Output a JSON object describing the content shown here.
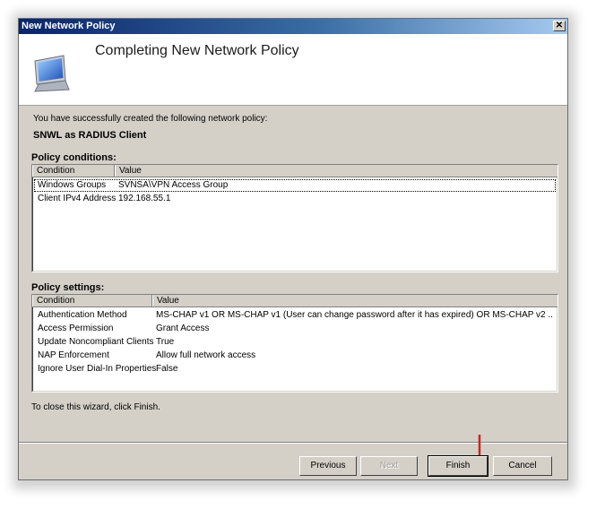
{
  "window": {
    "title": "New Network Policy",
    "close_glyph": "✕"
  },
  "header": {
    "heading": "Completing New Network Policy",
    "icon": "wizard-monitor-icon"
  },
  "intro_text": "You have successfully created the following network policy:",
  "policy_name": "SNWL as RADIUS Client",
  "conditions": {
    "section_label": "Policy conditions:",
    "columns": [
      "Condition",
      "Value"
    ],
    "rows": [
      {
        "condition": "Windows Groups",
        "value": "SVNSA\\VPN Access Group"
      },
      {
        "condition": "Client IPv4 Address",
        "value": "192.168.55.1"
      }
    ]
  },
  "settings": {
    "section_label": "Policy settings:",
    "columns": [
      "Condition",
      "Value"
    ],
    "rows": [
      {
        "condition": "Authentication Method",
        "value": "MS-CHAP v1 OR MS-CHAP v1 (User can change password after it has expired) OR MS-CHAP v2 ..."
      },
      {
        "condition": "Access Permission",
        "value": "Grant Access"
      },
      {
        "condition": "Update Noncompliant Clients",
        "value": "True"
      },
      {
        "condition": "NAP Enforcement",
        "value": "Allow full network access"
      },
      {
        "condition": "Ignore User Dial-In Properties",
        "value": "False"
      }
    ]
  },
  "footer_text": "To close this wizard, click Finish.",
  "buttons": {
    "previous": "Previous",
    "next": "Next",
    "finish": "Finish",
    "cancel": "Cancel"
  },
  "annotation": {
    "arrow_icon": "red-down-arrow-icon",
    "arrow_color": "#c8281e"
  }
}
